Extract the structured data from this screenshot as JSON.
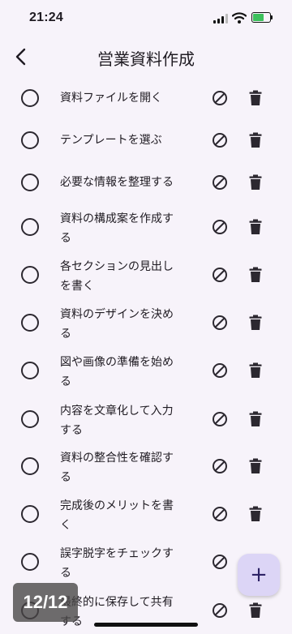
{
  "status_bar": {
    "time": "21:24"
  },
  "header": {
    "title": "営業資料作成"
  },
  "tasks": [
    {
      "line1": "資料ファイルを開く",
      "line2": ""
    },
    {
      "line1": "テンプレートを選ぶ",
      "line2": ""
    },
    {
      "line1": "必要な情報を整理する",
      "line2": ""
    },
    {
      "line1": "資料の構成案を作成す",
      "line2": "る"
    },
    {
      "line1": "各セクションの見出し",
      "line2": "を書く"
    },
    {
      "line1": "資料のデザインを決め",
      "line2": "る"
    },
    {
      "line1": "図や画像の準備を始め",
      "line2": "る"
    },
    {
      "line1": "内容を文章化して入力",
      "line2": "する"
    },
    {
      "line1": "資料の整合性を確認す",
      "line2": "る"
    },
    {
      "line1": "完成後のメリットを書",
      "line2": "く"
    },
    {
      "line1": "誤字脱字をチェックす",
      "line2": "る"
    },
    {
      "line1": "最終的に保存して共有",
      "line2": "する"
    }
  ],
  "fab": {
    "label": "+"
  },
  "page_counter": "12/12",
  "colors": {
    "background": "#f7f3fa",
    "fab": "#dcd5f6",
    "battery": "#3cc15c"
  },
  "icons": {
    "back": "chevron-left-icon",
    "block": "block-icon",
    "delete": "trash-icon"
  }
}
